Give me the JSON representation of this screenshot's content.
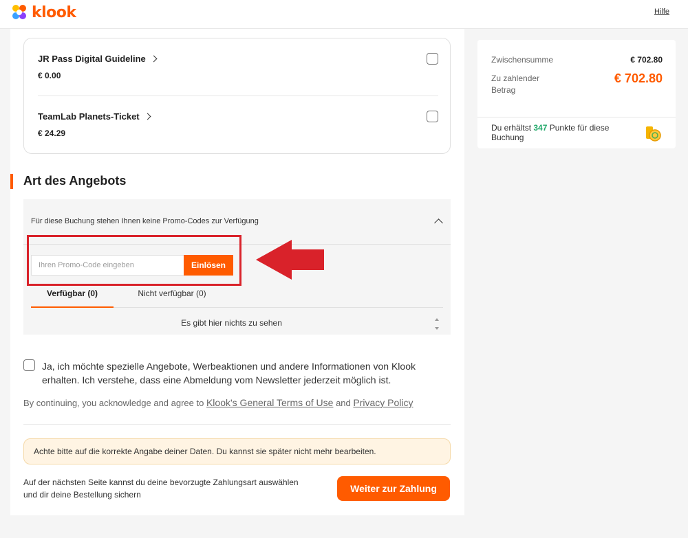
{
  "header": {
    "logo_text": "klook",
    "help_label": "Hilfe"
  },
  "addons": [
    {
      "title": "JR Pass Digital Guideline",
      "price": "€ 0.00",
      "checked": false
    },
    {
      "title": "TeamLab Planets-Ticket",
      "price": "€ 24.29",
      "checked": false
    }
  ],
  "offer_section": {
    "title": "Art des Angebots",
    "promo_header": "Für diese Buchung stehen Ihnen keine Promo-Codes zur Verfügung",
    "promo_placeholder": "Ihren Promo-Code eingeben",
    "redeem_label": "Einlösen",
    "tabs": [
      {
        "label": "Verfügbar (0)",
        "active": true
      },
      {
        "label": "Nicht verfügbar (0)",
        "active": false
      }
    ],
    "empty_text": "Es gibt hier nichts zu sehen"
  },
  "newsletter": {
    "text": "Ja, ich möchte spezielle Angebote, Werbeaktionen und andere Informationen von Klook erhalten. Ich verstehe, dass eine Abmeldung vom Newsletter jederzeit möglich ist.",
    "checked": false
  },
  "terms": {
    "prefix": "By continuing, you acknowledge and agree to ",
    "terms_link": "Klook's General Terms of Use",
    "and": " and ",
    "privacy_link": "Privacy Policy"
  },
  "warning_text": "Achte bitte auf die korrekte Angabe deiner Daten. Du kannst sie später nicht mehr bearbeiten.",
  "footer": {
    "next_info": "Auf der nächsten Seite kannst du deine bevorzugte Zahlungsart auswählen und dir deine Bestellung sichern",
    "continue_label": "Weiter zur Zahlung"
  },
  "summary": {
    "subtotal_label": "Zwischensumme",
    "subtotal_value": "€ 702.80",
    "due_label": "Zu zahlender Betrag",
    "due_value": "€ 702.80",
    "points_prefix": "Du erhältst ",
    "points_value": "347",
    "points_suffix": " Punkte für diese Buchung"
  },
  "colors": {
    "brand": "#ff5b00",
    "annotation_red": "#d9222a",
    "points_green": "#20a869"
  }
}
